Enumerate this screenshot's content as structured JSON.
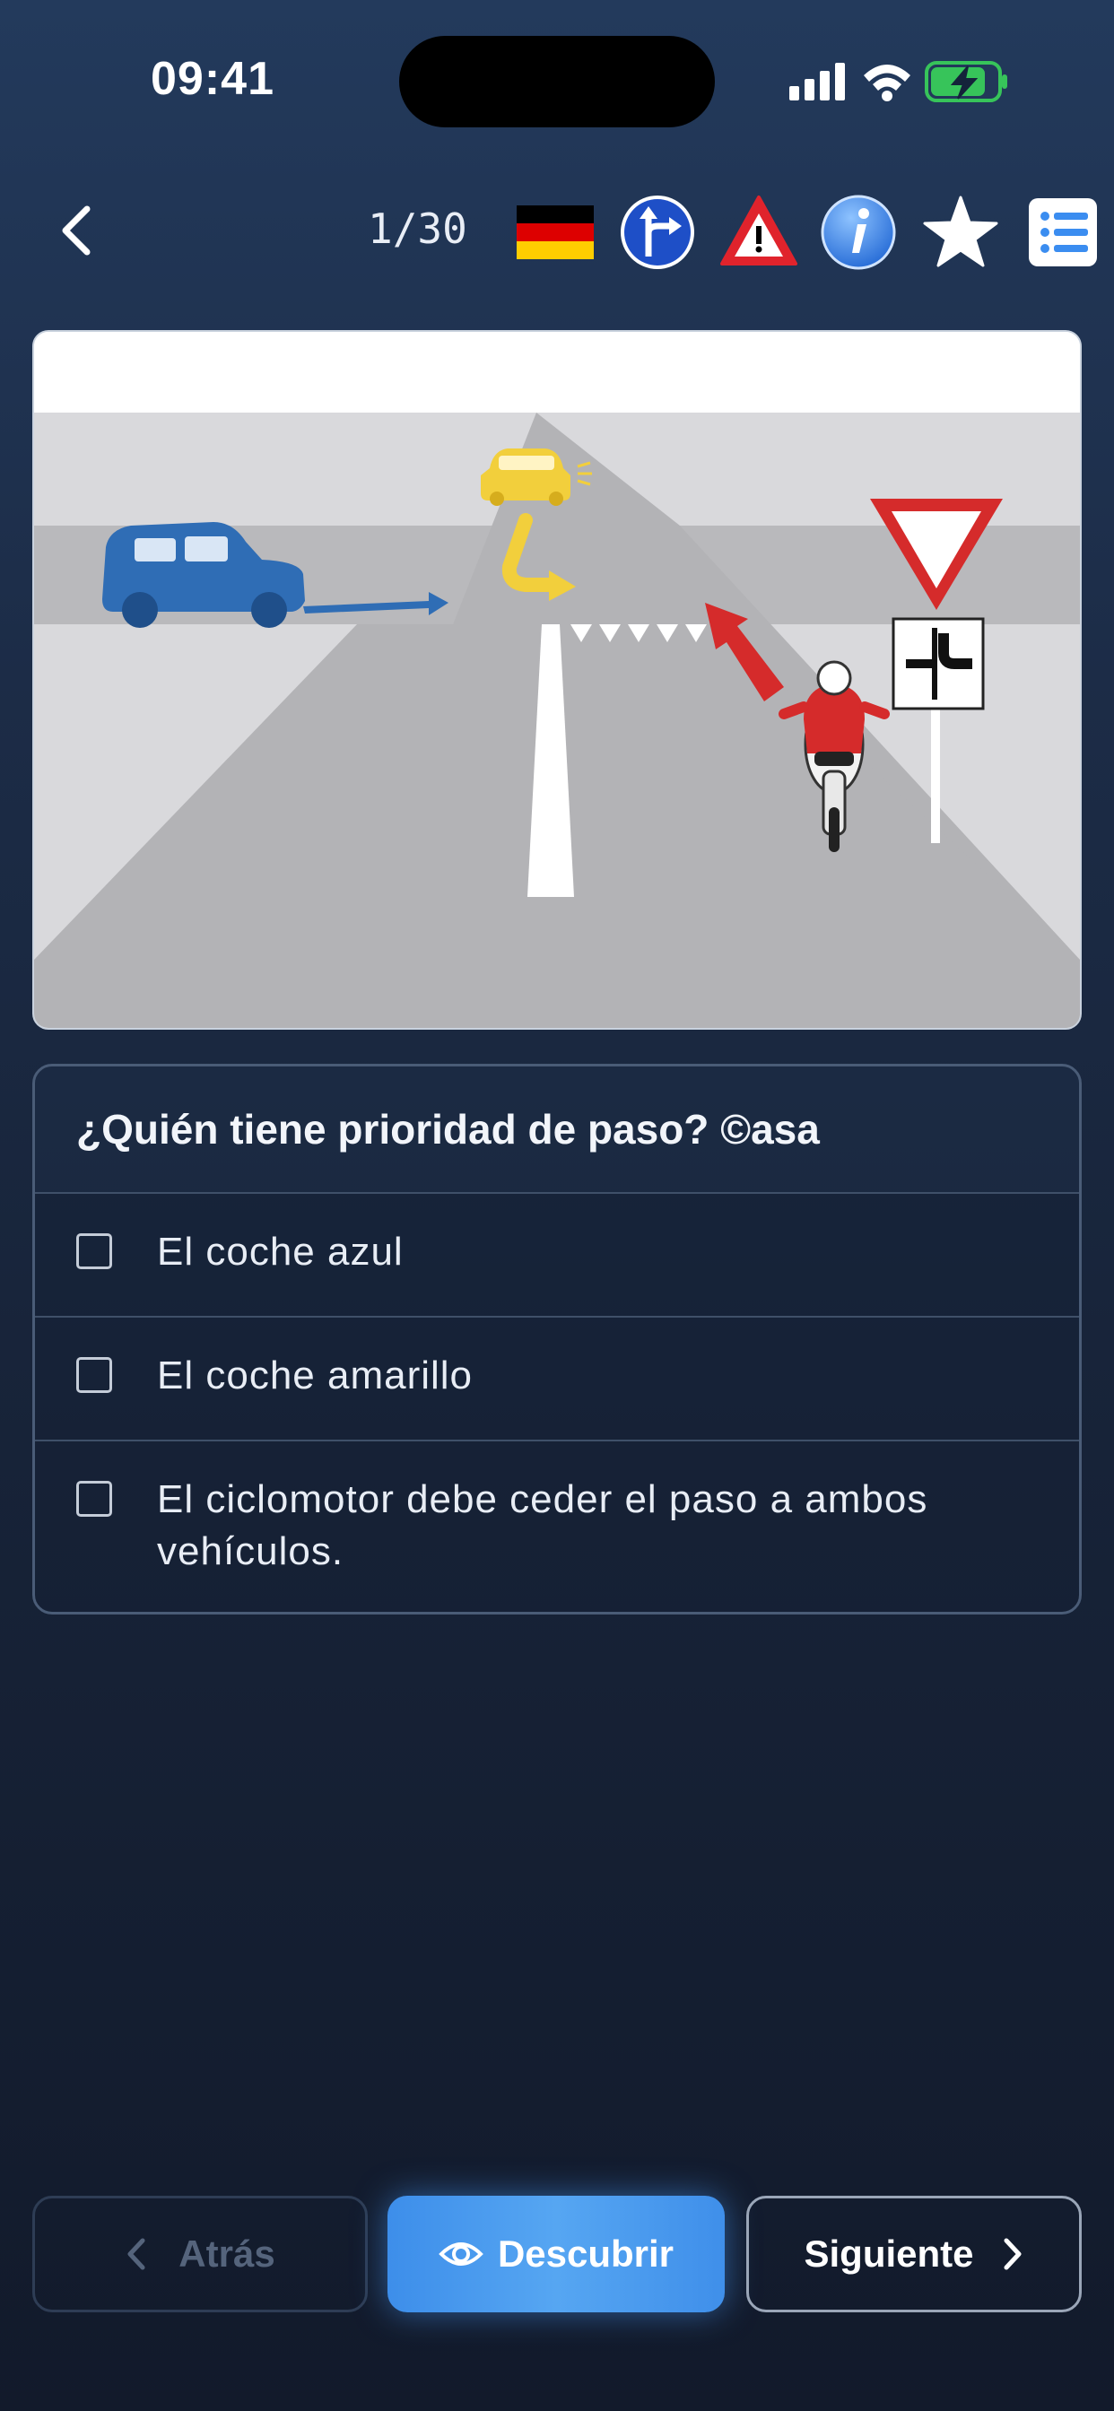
{
  "status_bar": {
    "time": "09:41"
  },
  "toolbar": {
    "counter": "1/30",
    "icons": [
      "germany-flag-icon",
      "direction-sign-icon",
      "warning-sign-icon",
      "info-icon",
      "star-icon",
      "list-icon"
    ]
  },
  "question": {
    "title": "¿Quién tiene prioridad de paso? ©asa",
    "options": [
      {
        "label": "El coche azul",
        "checked": false
      },
      {
        "label": "El coche amarillo",
        "checked": false
      },
      {
        "label": "El ciclomotor debe ceder el paso a ambos vehículos.",
        "checked": false
      }
    ]
  },
  "buttons": {
    "back_label": "Atrás",
    "reveal_label": "Descubrir",
    "next_label": "Siguiente"
  },
  "colors": {
    "accent": "#4a9af0",
    "blue_car": "#2f6db5",
    "yellow_car": "#f2cf3c",
    "red": "#d52b2b"
  }
}
